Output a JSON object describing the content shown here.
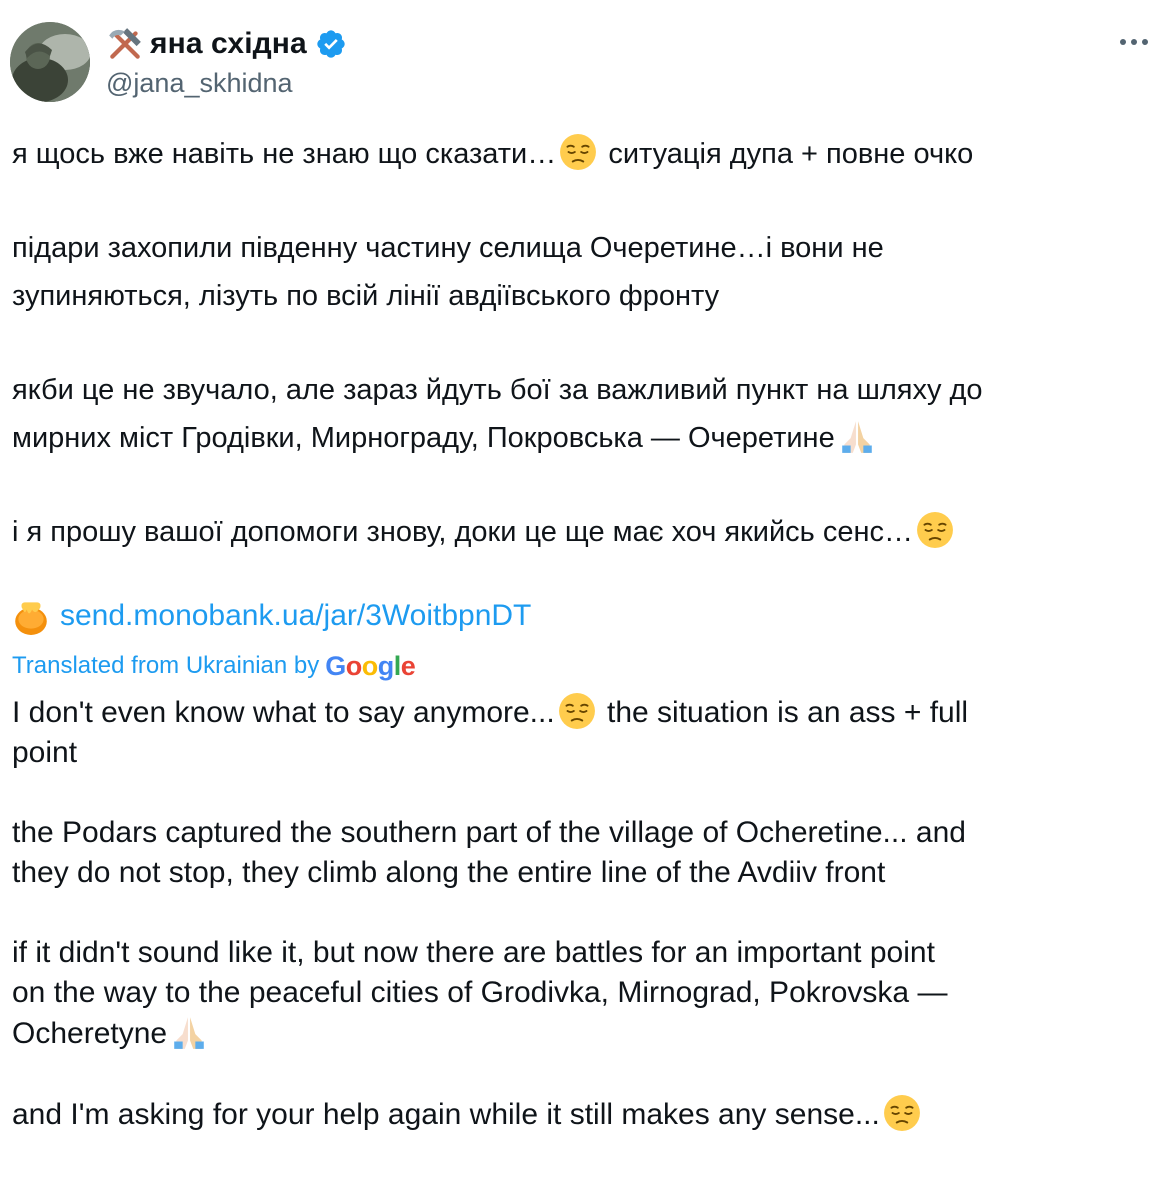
{
  "author": {
    "display_name": "яна східна",
    "handle": "@jana_skhidna",
    "name_icon": "hammer-and-pick-icon",
    "verified_icon": "verified-badge-icon",
    "verified_color": "#1d9bf0"
  },
  "header": {
    "more_icon": "more-options-icon"
  },
  "tweet": {
    "original": {
      "p1": {
        "line1_text": "я щось вже навіть не знаю що сказати…",
        "line1_emoji": "pensive-face-emoji",
        "line1_text2": " ситуація дупа + повне очко"
      },
      "p2": {
        "line1": "підари захопили південну частину селища Очеретине…і вони не",
        "line2": "зупиняються, лізуть по всій лінії авдіївського фронту"
      },
      "p3": {
        "line1": "якби це не звучало, але зараз йдуть бої за важливий пункт на шляху до",
        "line2": "мирних міст Гродівки, Мирнограду, Покровська — Очеретине",
        "line2_emoji": "folded-hands-emoji"
      },
      "p4": {
        "line1": "і я прошу вашої допомоги знову, доки це ще має хоч якийсь сенс…",
        "line1_emoji": "pensive-face-emoji"
      },
      "link": {
        "icon": "honey-pot-emoji",
        "text": "send.monobank.ua/jar/3WoitbpnDT"
      }
    },
    "translation": {
      "label": "Translated from Ukrainian by",
      "provider": "Google",
      "link_color": "#1d9bf0",
      "p1": {
        "line1_text": "I don't even know what to say anymore...",
        "line1_text2": " the situation is an ass + full",
        "line2": "point"
      },
      "p2": {
        "line1": "the Podars captured the southern part of the village of Ocheretine... and",
        "line2": "they do not stop, they climb along the entire line of the Avdiiv front"
      },
      "p3": {
        "line1": "if it didn't sound like it, but now there are battles for an important point",
        "line2": "on the way to the peaceful cities of Grodivka, Mirnograd, Pokrovska —",
        "line3": "Ocheretyne"
      },
      "p4": {
        "line1": "and I'm asking for your help again while it still makes any sense..."
      }
    }
  }
}
